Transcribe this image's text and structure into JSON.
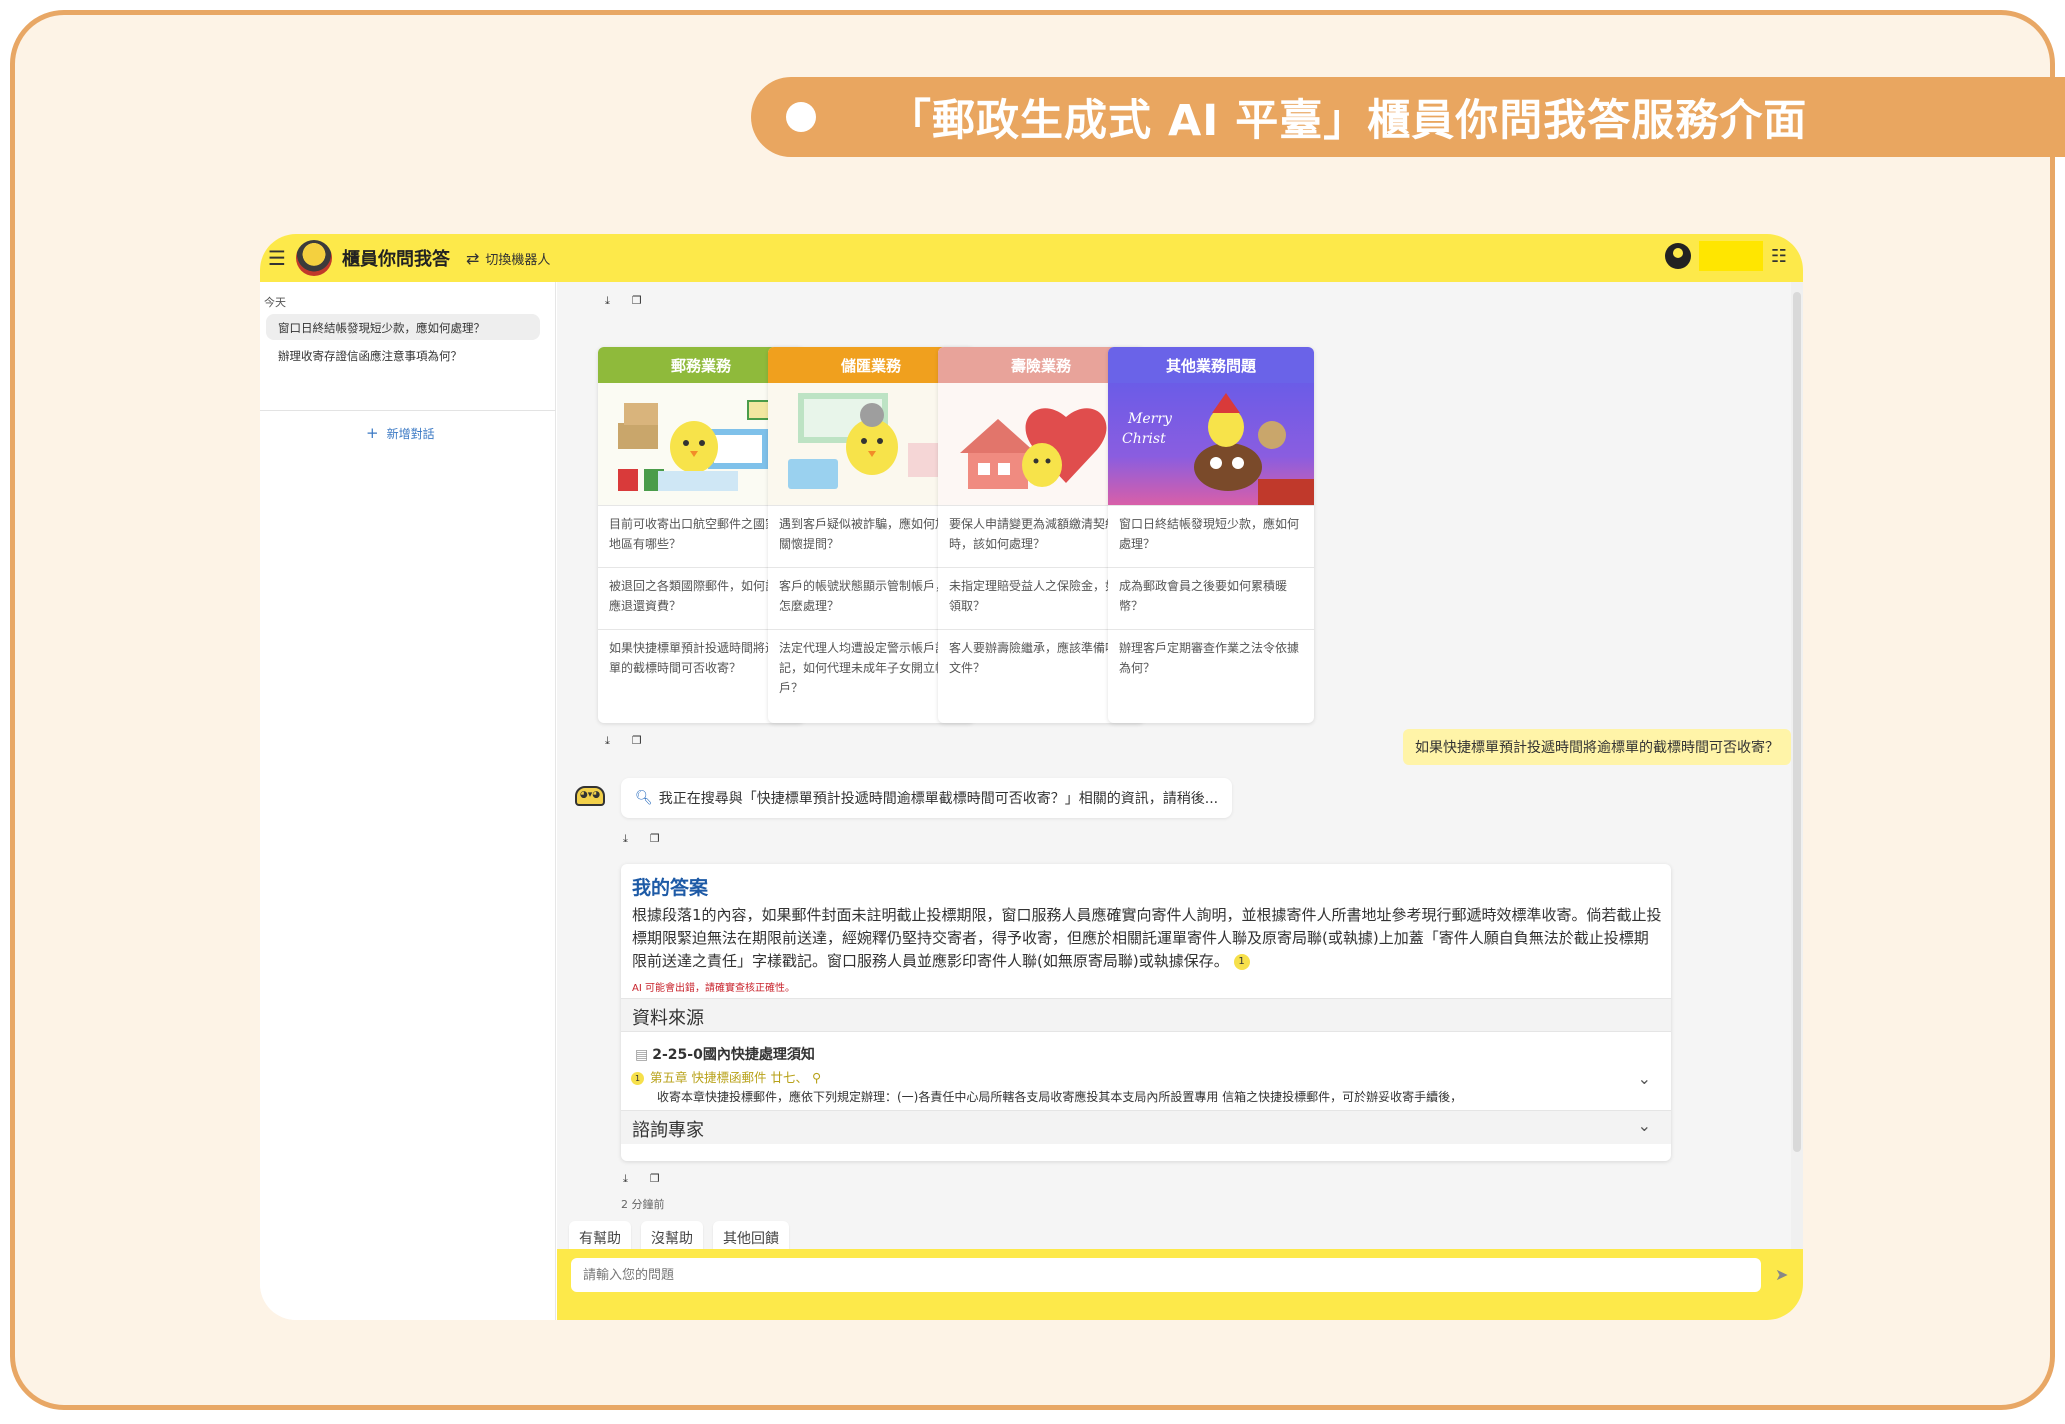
{
  "banner": {
    "title": "「郵政生成式 AI 平臺」櫃員你問我答服務介面"
  },
  "topbar": {
    "menu_icon": "menu-icon",
    "app_title": "櫃員你問我答",
    "switch_icon": "swap-arrows-icon",
    "switch_label": "切換機器人",
    "user_icon": "user-circle-icon",
    "settings_icon": "sliders-icon"
  },
  "sidebar": {
    "section_label": "今天",
    "history": [
      "窗口日終結帳發現短少款，應如何處理？",
      "辦理收寄存證信函應注意事項為何？"
    ],
    "new_chat_label": "新增對話"
  },
  "actions": {
    "download_icon": "download-icon",
    "copy_icon": "copy-icon"
  },
  "cards": [
    {
      "title": "郵務業務",
      "color": "#8fba3b",
      "questions": [
        "目前可收寄出口航空郵件之國家或地區有哪些？",
        "被退回之各類國際郵件，如何計算應退還資費？",
        "如果快捷標單預計投遞時間將逾標單的截標時間可否收寄？"
      ]
    },
    {
      "title": "儲匯業務",
      "color": "#f0a01e",
      "questions": [
        "遇到客戶疑似被詐騙，應如何加強關懷提問？",
        "客戶的帳號狀態顯示管制帳戶，該怎麼處理？",
        "法定代理人均遭設定警示帳戶註記，如何代理未成年子女開立帳戶？"
      ]
    },
    {
      "title": "壽險業務",
      "color": "#e8a39a",
      "questions": [
        "要保人申請變更為減額繳清契約時，該如何處理？",
        "未指定理賠受益人之保險金，如何領取？",
        "客人要辦壽險繼承，應該準備哪些文件？"
      ]
    },
    {
      "title": "其他業務問題",
      "color": "#6a63e8",
      "questions": [
        "窗口日終結帳發現短少款，應如何處理？",
        "成為郵政會員之後要如何累積暖幣？",
        "辦理客戶定期審查作業之法令依據為何？"
      ]
    }
  ],
  "chat": {
    "user_question": "如果快捷標單預計投遞時間將逾標單的截標時間可否收寄？",
    "bot_avatar_icon": "robot-mascot-icon",
    "bot_avatar_label": "◕▾◕",
    "search_icon": "magnifier-icon",
    "searching_text": "我正在搜尋與「快捷標單預計投遞時間逾標單截標時間可否收寄？」相關的資訊，請稍後...",
    "answer_title": "我的答案",
    "answer_text": "根據段落1的內容，如果郵件封面未註明截止投標期限，窗口服務人員應確實向寄件人詢明，並根據寄件人所書地址參考現行郵遞時效標準收寄。倘若截止投標期限緊迫無法在期限前送達，經婉釋仍堅持交寄者，得予收寄，但應於相關託運單寄件人聯及原寄局聯(或執據)上加蓋「寄件人願自負無法於截止投標期限前送達之責任」字樣戳記。窗口服務人員並應影印寄件人聯(如無原寄局聯)或執據保存。",
    "citation_number": "1",
    "ai_warning": "AI 可能會出錯，請確實查核正確性。",
    "sources_label": "資料來源",
    "doc_icon": "document-icon",
    "doc_title": "2-25-0國內快捷處理須知",
    "chapter_text": "第五章 快捷標函郵件 廿七、",
    "link_icon": "link-icon",
    "snippet": "收寄本章快捷投標郵件，應依下列規定辦理：(一)各責任中心局所轄各支局收寄應投其本支局內所設置專用 信箱之快捷投標郵件，可於辦妥收寄手續後，",
    "expand_icon": "chevron-down-icon",
    "expert_label": "諮詢專家",
    "timestamp": "2 分鐘前",
    "feedback": [
      "有幫助",
      "沒幫助",
      "其他回饋"
    ]
  },
  "input": {
    "placeholder": "請輸入您的問題",
    "send_icon": "send-icon"
  }
}
